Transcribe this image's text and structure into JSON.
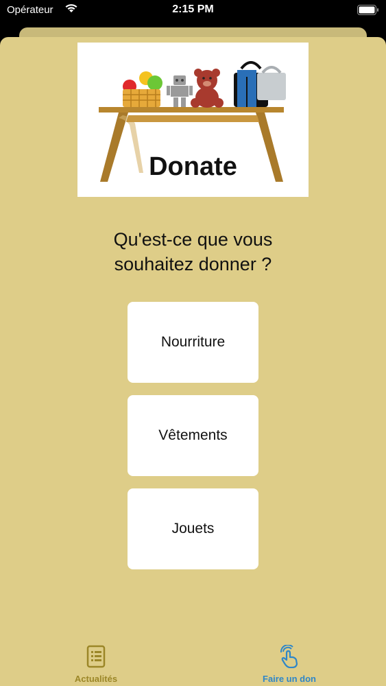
{
  "status": {
    "carrier": "Opérateur",
    "time": "2:15 PM",
    "wifi_icon": "wifi-icon",
    "battery_icon": "battery-full-icon"
  },
  "hero": {
    "title": "Donate",
    "image_items": [
      "fruit-basket-icon",
      "robot-toy-icon",
      "teddy-bear-icon",
      "jeans-icon",
      "handbag-icon",
      "table-icon"
    ]
  },
  "question": {
    "line1": "Qu'est-ce que vous",
    "line2": "souhaitez donner ?"
  },
  "options": [
    {
      "label": "Nourriture"
    },
    {
      "label": "Vêtements"
    },
    {
      "label": "Jouets"
    }
  ],
  "tabs": [
    {
      "label": "Actualités",
      "icon": "news-icon",
      "selected": false
    },
    {
      "label": "Faire un don",
      "icon": "hand-tap-icon",
      "selected": true
    }
  ],
  "colors": {
    "background": "#decd88",
    "tab_selected": "#2e86c8",
    "tab_unselected": "#9b8627"
  }
}
